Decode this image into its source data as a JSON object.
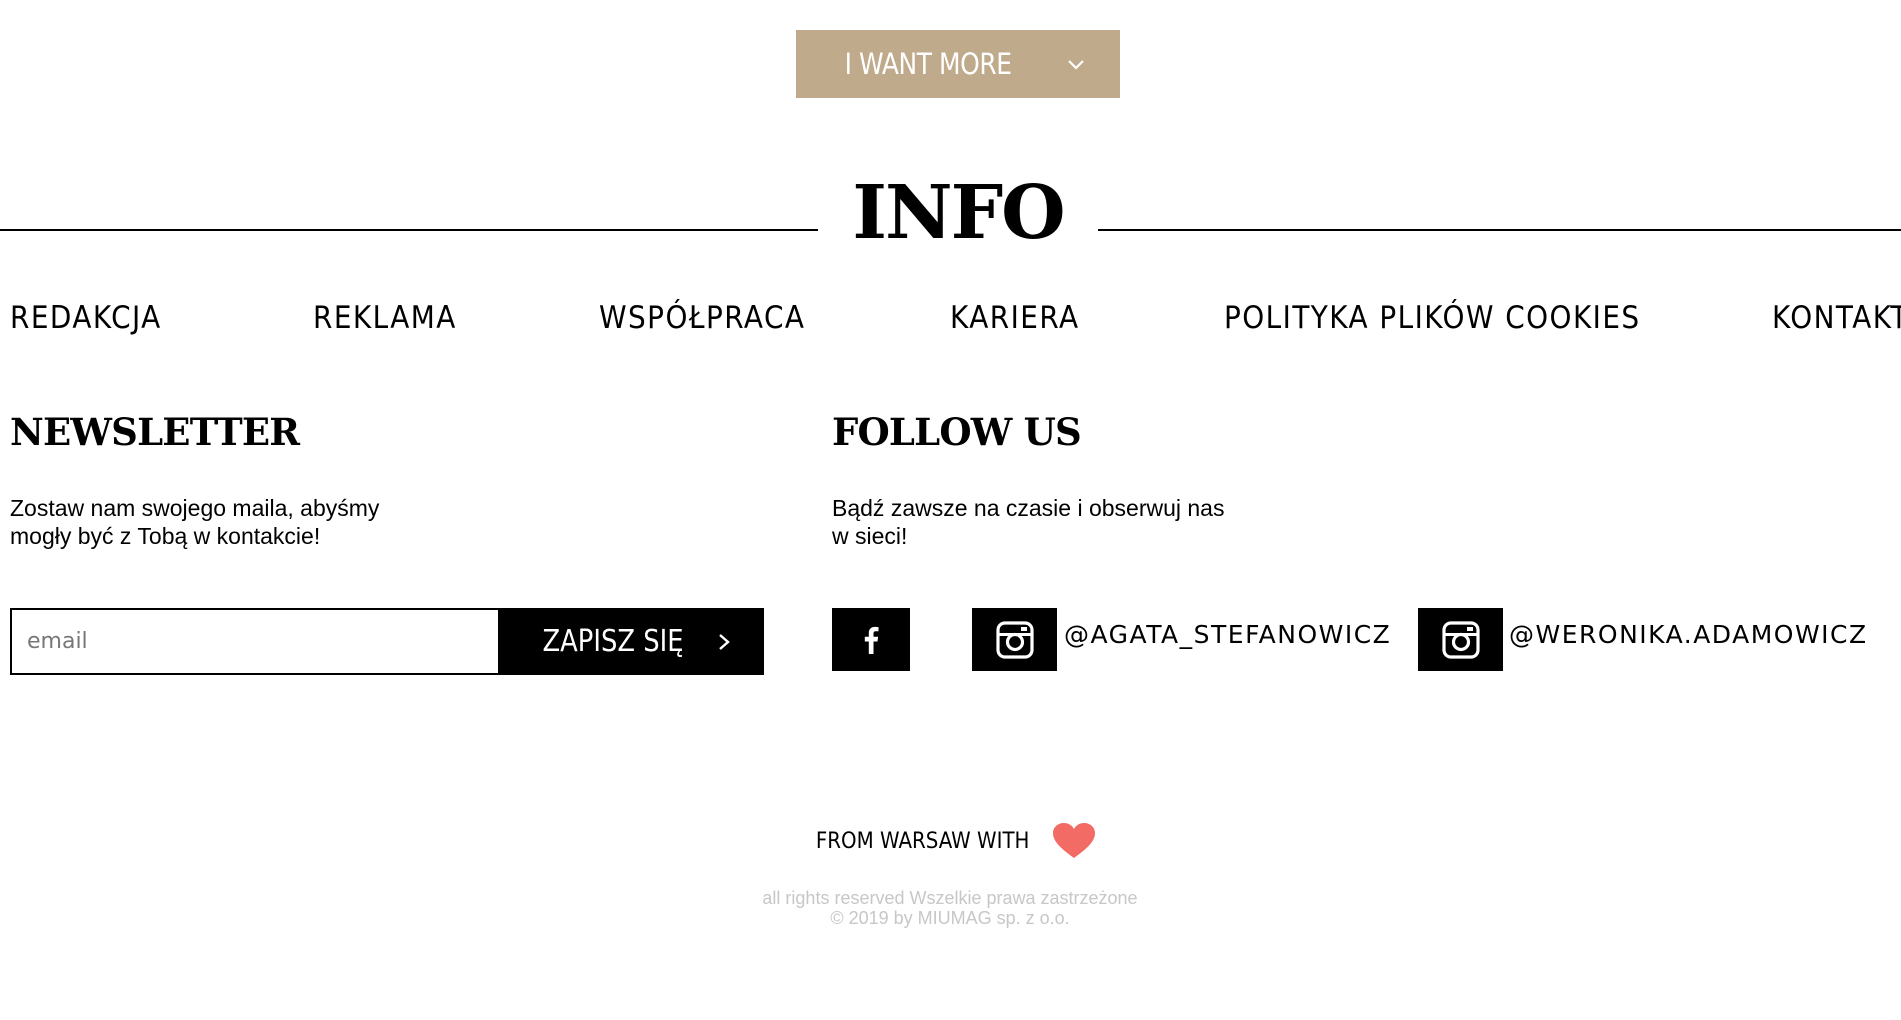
{
  "more_button": {
    "label": "I WANT MORE",
    "icon": "chevron-down-icon"
  },
  "info": {
    "title": "INFO"
  },
  "nav": [
    {
      "label": "REDAKCJA"
    },
    {
      "label": "REKLAMA"
    },
    {
      "label": "WSPÓŁPRACA"
    },
    {
      "label": "KARIERA"
    },
    {
      "label": "POLITYKA PLIKÓW COOKIES"
    },
    {
      "label": "KONTAKT"
    }
  ],
  "newsletter": {
    "title": "NEWSLETTER",
    "text_line1": "Zostaw nam swojego maila, abyśmy",
    "text_line2": "mogły być z Tobą w kontakcie!",
    "email_placeholder": "email",
    "email_value": "",
    "submit_label": "ZAPISZ SIĘ",
    "submit_icon": "chevron-right-icon"
  },
  "follow": {
    "title": "FOLLOW US",
    "text_line1": "Bądź zawsze na czasie i obserwuj nas",
    "text_line2": "w sieci!",
    "facebook_icon": "facebook-icon",
    "instagram_icon": "instagram-icon",
    "handle1": "@AGATA_STEFANOWICZ",
    "handle2": "@WERONIKA.ADAMOWICZ"
  },
  "footer": {
    "from_warsaw": "FROM WARSAW WITH",
    "heart_icon": "heart-icon",
    "heart_color": "#f26b64",
    "rights": "all rights reserved Wszelkie prawa zastrzeżone",
    "copyright": "© 2019 by MIUMAG sp. z o.o."
  },
  "colors": {
    "accent": "#bfaa8b",
    "text": "#000000",
    "muted": "#c7c7c7"
  }
}
